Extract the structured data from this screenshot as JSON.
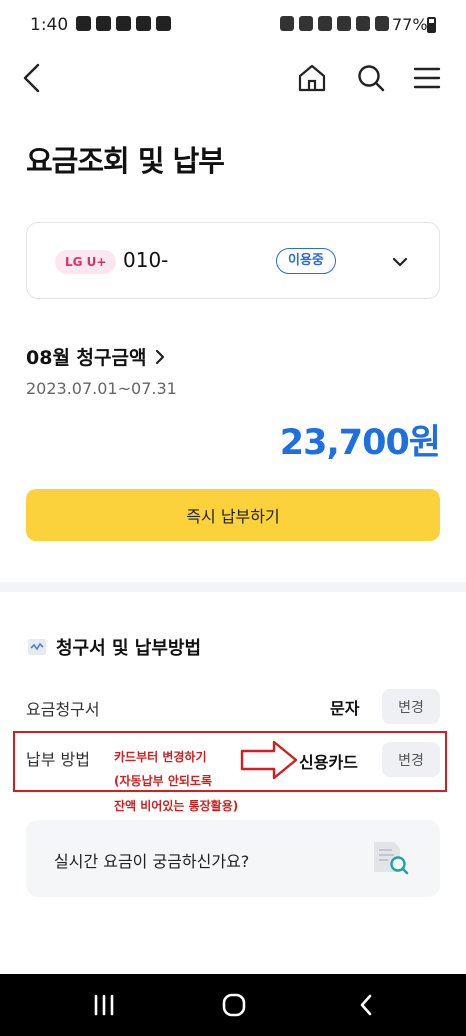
{
  "status_bar": {
    "time": "1:40",
    "battery": "77%"
  },
  "header": {
    "title": "요금조회 및 납부"
  },
  "line": {
    "carrier": "LG U+",
    "phone": "010-",
    "status": "이용중"
  },
  "billing": {
    "month_label": "08월 청구금액",
    "period": "2023.07.01~07.31",
    "amount": "23,700원",
    "pay_button": "즉시 납부하기"
  },
  "section": {
    "title": "청구서 및 납부방법",
    "rows": [
      {
        "label": "요금청구서",
        "value": "문자",
        "button": "변경"
      },
      {
        "label": "납부 방법",
        "value": "신용카드",
        "button": "변경"
      }
    ]
  },
  "annotation": {
    "line1": "카드부터 변경하기",
    "line2": "(자동납부 안되도록",
    "line3": "잔액 비어있는 통장활용)"
  },
  "realtime": {
    "text": "실시간 요금이 궁금하신가요?"
  },
  "colors": {
    "accent_blue": "#1f6fe0",
    "pay_yellow": "#fcd23c",
    "annotation_red": "#d21f1f",
    "carrier_pink": "#d6336c"
  }
}
